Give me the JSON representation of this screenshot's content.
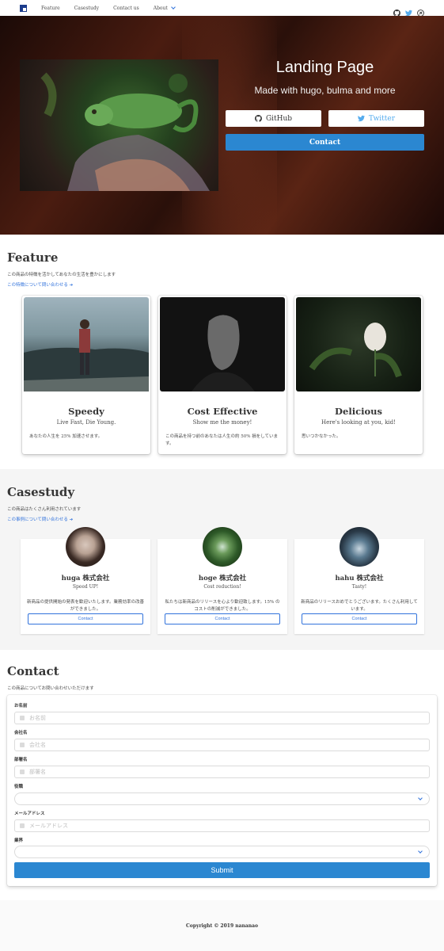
{
  "nav": {
    "items": [
      "Feature",
      "Casestudy",
      "Contact us",
      "About"
    ],
    "icons": [
      "github-icon",
      "twitter-icon",
      "blog-icon"
    ]
  },
  "hero": {
    "title": "Landing Page",
    "subtitle": "Made with hugo, bulma and more",
    "github_label": "GitHub",
    "twitter_label": "Twitter",
    "contact_label": "Contact"
  },
  "feature": {
    "title": "Feature",
    "subtitle": "この商品の特徴を活かしてあなたの生活を豊かにします",
    "link": "この特徴について問い合わせる",
    "cards": [
      {
        "title": "Speedy",
        "subtitle": "Live Fast, Die Young.",
        "desc": "あなたの人生を 25% 加速させます。"
      },
      {
        "title": "Cost Effective",
        "subtitle": "Show me the money!",
        "desc": "この商品を持つ前のあなたは人生の約 50% 損をしています。"
      },
      {
        "title": "Delicious",
        "subtitle": "Here's looking at you, kid!",
        "desc": "思いつかなかった。"
      }
    ]
  },
  "casestudy": {
    "title": "Casestudy",
    "subtitle": "この商品はたくさん利用されています",
    "link": "この事例について問い合わせる",
    "cards": [
      {
        "name": "huga 株式会社",
        "tagline": "Speed UP!",
        "desc": "新商品の提供開始の発表を歓迎いたします。業務効率の改善ができました。",
        "button": "Contact"
      },
      {
        "name": "hoge 株式会社",
        "tagline": "Cost reduction!",
        "desc": "私たちは新商品のリリースを心より歓迎致します。15% のコストの削減ができました。",
        "button": "Contact"
      },
      {
        "name": "hahu 株式会社",
        "tagline": "Tasty!",
        "desc": "新商品のリリースおめでとうございます。たくさん利用しています。",
        "button": "Contact"
      }
    ]
  },
  "contact": {
    "title": "Contact",
    "subtitle": "この商品についてお問い合わせいただけます",
    "fields": {
      "name_label": "お名前",
      "name_placeholder": "お名前",
      "company_label": "会社名",
      "company_placeholder": "会社名",
      "dept_label": "部署名",
      "dept_placeholder": "部署名",
      "position_label": "役職",
      "email_label": "メールアドレス",
      "email_placeholder": "メールアドレス",
      "industry_label": "業界"
    },
    "submit": "Submit"
  },
  "footer": {
    "copyright": "Copyright © 2019 nananao"
  },
  "colors": {
    "primary": "#2b87d1",
    "link": "#3273dc",
    "twitter": "#55acee"
  }
}
